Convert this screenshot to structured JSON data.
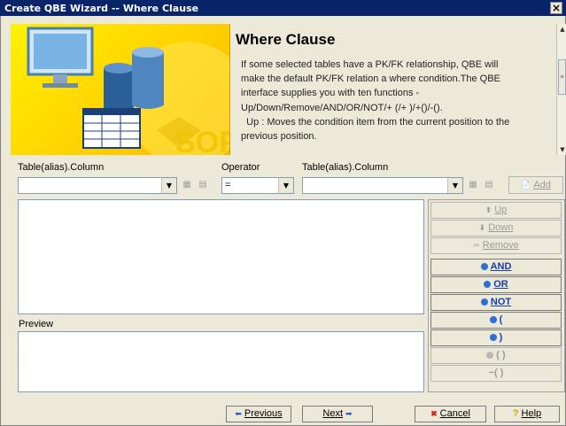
{
  "window": {
    "title": "Create QBE Wizard -- Where Clause",
    "close_glyph": "×"
  },
  "header": {
    "title": "Where Clause",
    "desc_line1": "If some selected tables have a PK/FK relationship, QBE will",
    "desc_line2": "make the default PK/FK relation a where condition.The QBE",
    "desc_line3": "interface supplies you with ten functions -",
    "desc_line4": "Up/Down/Remove/AND/OR/NOT/+ (/+ )/+()/-().",
    "desc_line5": "Up : Moves the condition item from the current position to the",
    "desc_line6": "previous position.",
    "logo_fragment": "SOF",
    "colors": {
      "banner": "#ffd200",
      "accent": "#0a246a"
    }
  },
  "labels": {
    "left_column": "Table(alias).Column",
    "operator": "Operator",
    "right_column": "Table(alias).Column",
    "preview": "Preview"
  },
  "operator": {
    "value": "="
  },
  "left_combo": {
    "value": ""
  },
  "right_combo": {
    "value": ""
  },
  "add_button": {
    "label": "Add"
  },
  "side_buttons": {
    "up": "Up",
    "down": "Down",
    "remove": "Remove",
    "and": "AND",
    "or": "OR",
    "not": "NOT",
    "open_paren": "(",
    "close_paren": ")",
    "plus_paren": "( )",
    "minus_paren": "( )",
    "plus_sign": "+",
    "minus_sign": "−"
  },
  "footer": {
    "previous": "Previous",
    "next": "Next",
    "cancel": "Cancel",
    "help": "Help"
  }
}
